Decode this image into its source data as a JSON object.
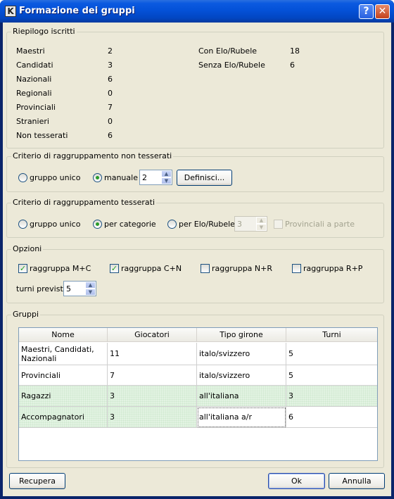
{
  "window": {
    "title": "Formazione dei gruppi",
    "icon_letter": "K",
    "help_glyph": "?",
    "close_glyph": "✕"
  },
  "summary": {
    "title": "Riepilogo iscritti",
    "left": [
      {
        "label": "Maestri",
        "value": "2"
      },
      {
        "label": "Candidati",
        "value": "3"
      },
      {
        "label": "Nazionali",
        "value": "6"
      },
      {
        "label": "Regionali",
        "value": "0"
      },
      {
        "label": "Provinciali",
        "value": "7"
      },
      {
        "label": "Stranieri",
        "value": "0"
      },
      {
        "label": "Non tesserati",
        "value": "6"
      }
    ],
    "right": [
      {
        "label": "Con Elo/Rubele",
        "value": "18"
      },
      {
        "label": "Senza Elo/Rubele",
        "value": "6"
      }
    ]
  },
  "non_tesserati": {
    "title": "Criterio di raggruppamento non tesserati",
    "option_unico": "gruppo unico",
    "option_manuale": "manuale",
    "selected": "manuale",
    "spin_value": "2",
    "define_button": "Definisci..."
  },
  "tesserati": {
    "title": "Criterio di raggruppamento tesserati",
    "option_unico": "gruppo unico",
    "option_categorie": "per categorie",
    "option_elo": "per Elo/Rubele",
    "selected": "per categorie",
    "spin_value": "3",
    "provinciali_label": "Provinciali a parte"
  },
  "opzioni": {
    "title": "Opzioni",
    "checks": [
      {
        "label": "raggruppa M+C",
        "checked": true
      },
      {
        "label": "raggruppa C+N",
        "checked": true
      },
      {
        "label": "raggruppa N+R",
        "checked": false
      },
      {
        "label": "raggruppa R+P",
        "checked": false
      }
    ],
    "turni_label": "turni previsti",
    "turni_value": "5"
  },
  "gruppi": {
    "title": "Gruppi",
    "columns": [
      "Nome",
      "Giocatori",
      "Tipo girone",
      "Turni"
    ],
    "rows": [
      {
        "nome": "Maestri, Candidati, Nazionali",
        "giocatori": "11",
        "tipo": "italo/svizzero",
        "turni": "5"
      },
      {
        "nome": "Provinciali",
        "giocatori": "7",
        "tipo": "italo/svizzero",
        "turni": "5"
      },
      {
        "nome": "Ragazzi",
        "giocatori": "3",
        "tipo": "all'italiana",
        "turni": "3"
      },
      {
        "nome": "Accompagnatori",
        "giocatori": "3",
        "tipo": "all'italiana a/r",
        "turni": "6"
      }
    ]
  },
  "footer": {
    "recupera": "Recupera",
    "ok": "Ok",
    "annulla": "Annulla"
  }
}
